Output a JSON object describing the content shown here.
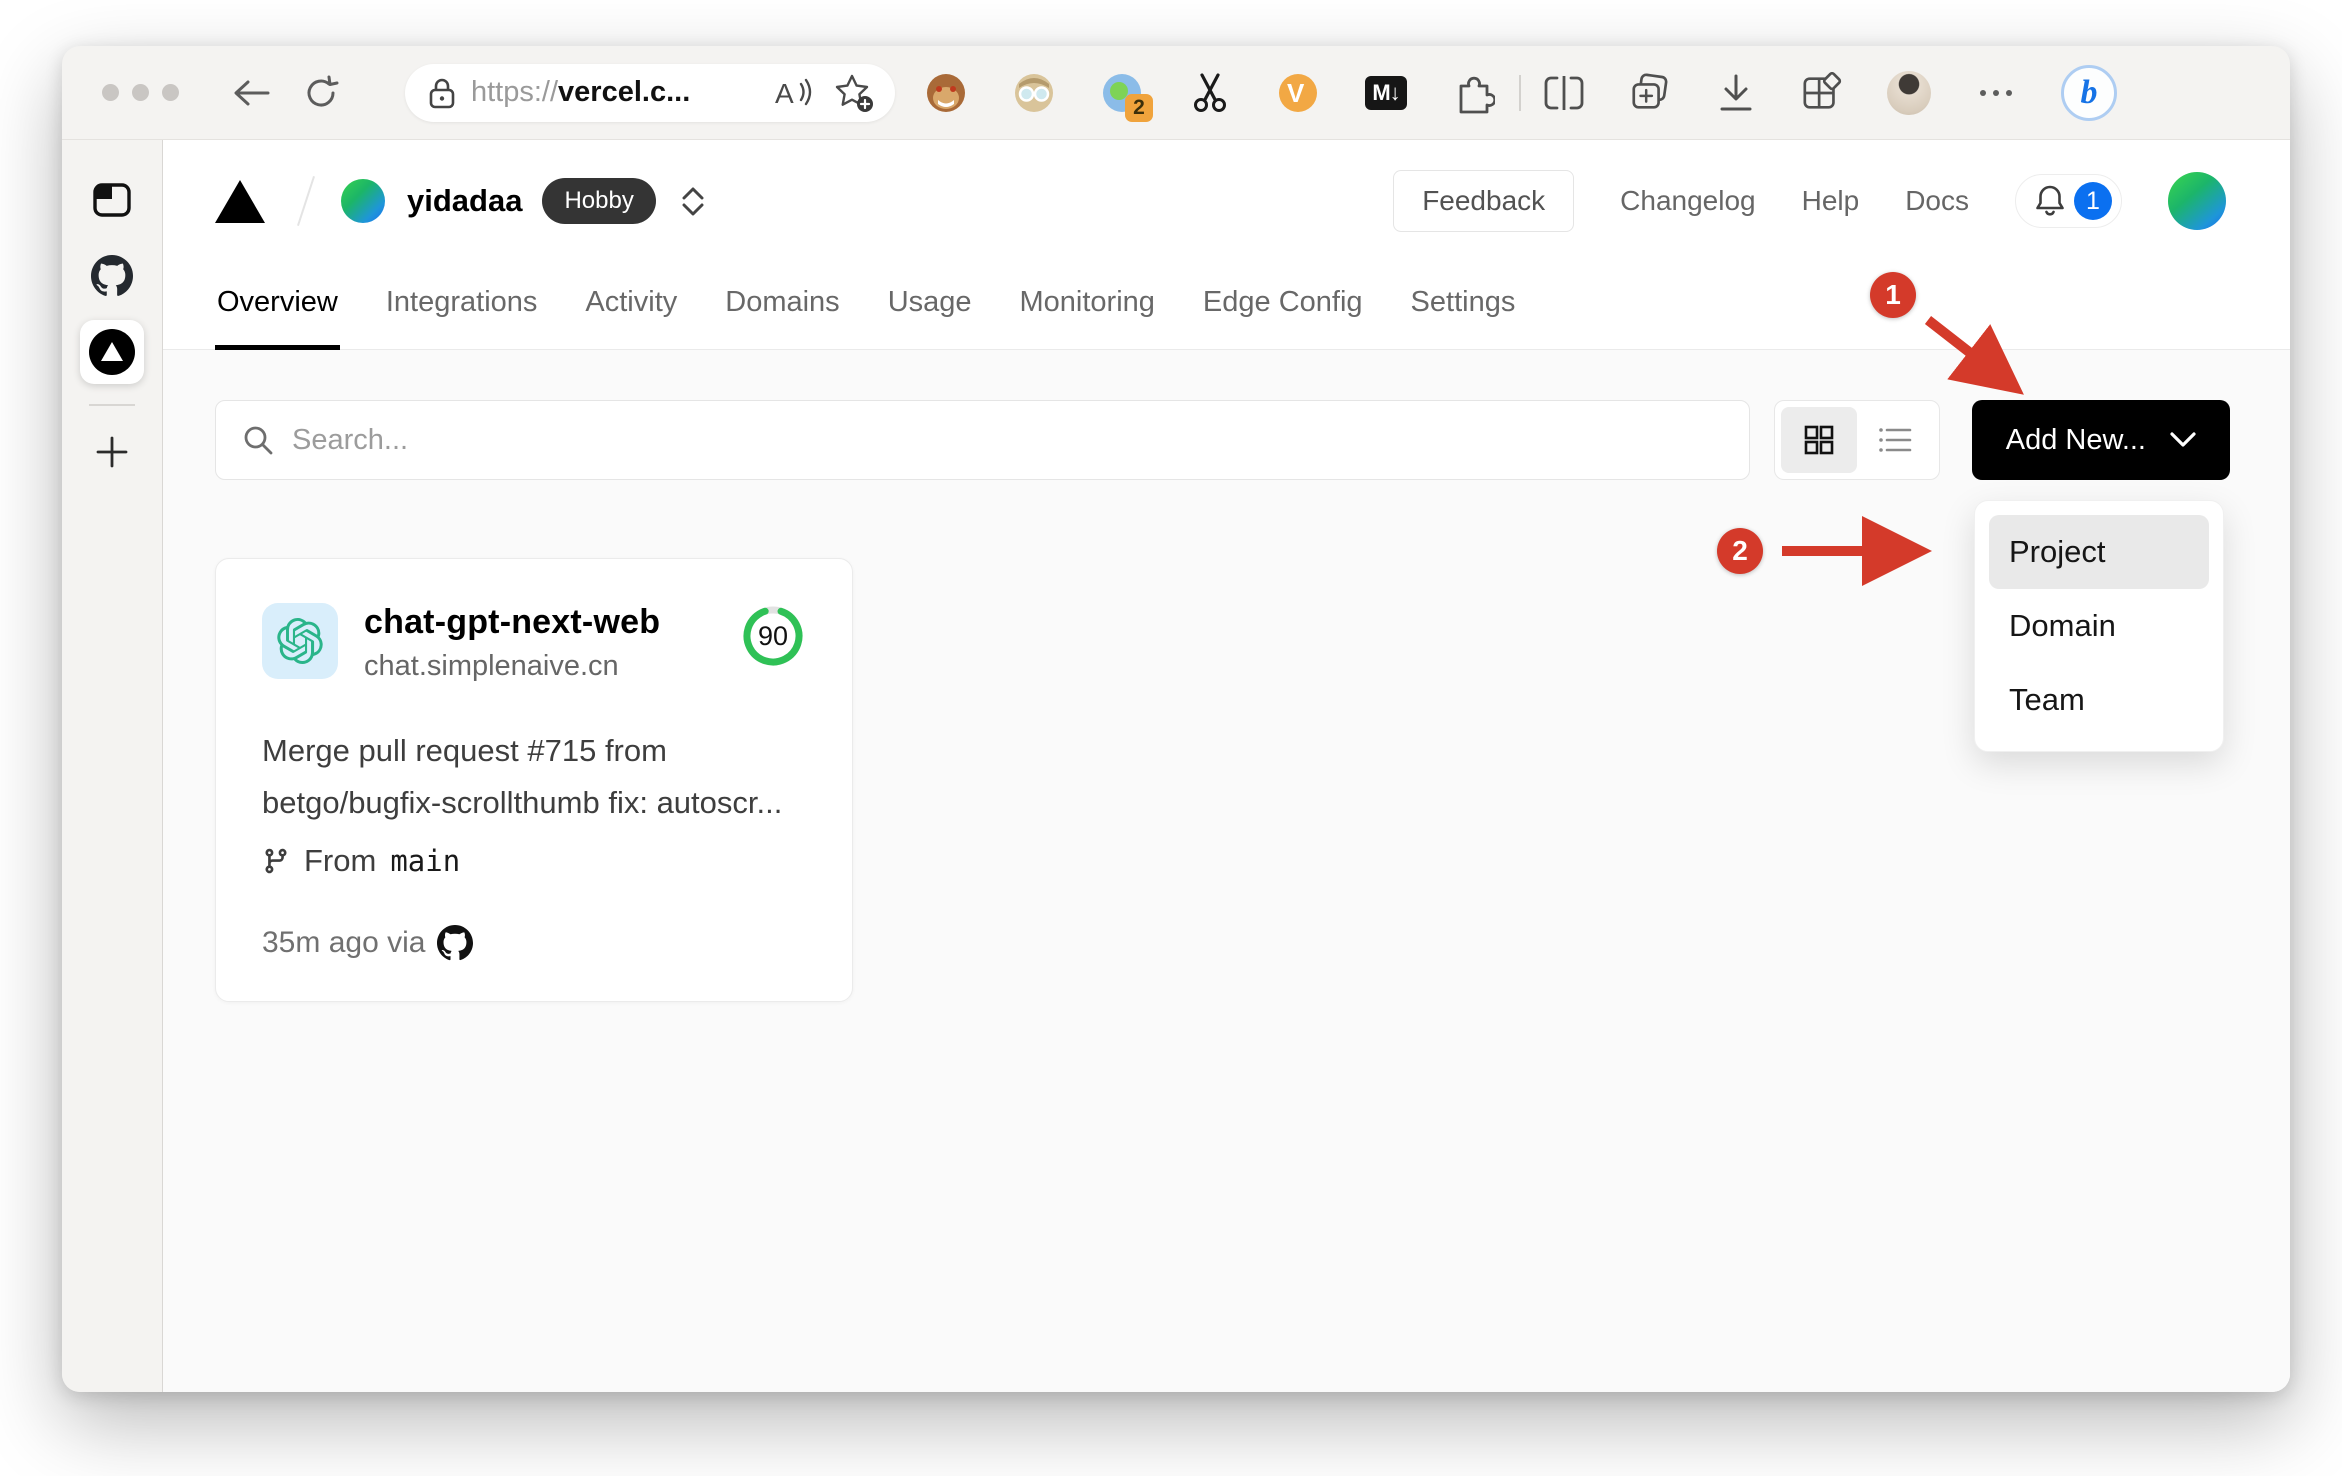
{
  "browser": {
    "url": {
      "scheme": "https://",
      "host": "vercel.c..."
    },
    "extensions_badge_count": "2",
    "markdown_ext_label": "M↓",
    "video_ext_label": "V",
    "bing_label": "b"
  },
  "vercel": {
    "header": {
      "team_name": "yidadaa",
      "plan_badge": "Hobby",
      "feedback_label": "Feedback",
      "links": [
        "Changelog",
        "Help",
        "Docs"
      ],
      "notification_count": "1"
    },
    "tabs": [
      "Overview",
      "Integrations",
      "Activity",
      "Domains",
      "Usage",
      "Monitoring",
      "Edge Config",
      "Settings"
    ],
    "active_tab": "Overview",
    "toolbar": {
      "search_placeholder": "Search...",
      "add_new_label": "Add New..."
    },
    "dropdown": {
      "items": [
        "Project",
        "Domain",
        "Team"
      ],
      "highlighted": "Project"
    },
    "project_card": {
      "name": "chat-gpt-next-web",
      "domain": "chat.simplenaive.cn",
      "score": "90",
      "commit_message": "Merge pull request #715 from betgo/bugfix-scrollthumb fix: autoscr...",
      "branch_prefix": "From",
      "branch_name": "main",
      "deployed_meta": "35m ago via"
    }
  },
  "annotations": {
    "step1": "1",
    "step2": "2"
  },
  "colors": {
    "annotation_red": "#d43a2a",
    "notification_blue": "#0b70f0",
    "score_green": "#2fc156",
    "openai_green": "#2ab58a",
    "project_tile_blue": "#d9eefb",
    "add_new_bg": "#000000",
    "plan_badge_bg": "#343434",
    "content_bg": "#fafafa"
  }
}
